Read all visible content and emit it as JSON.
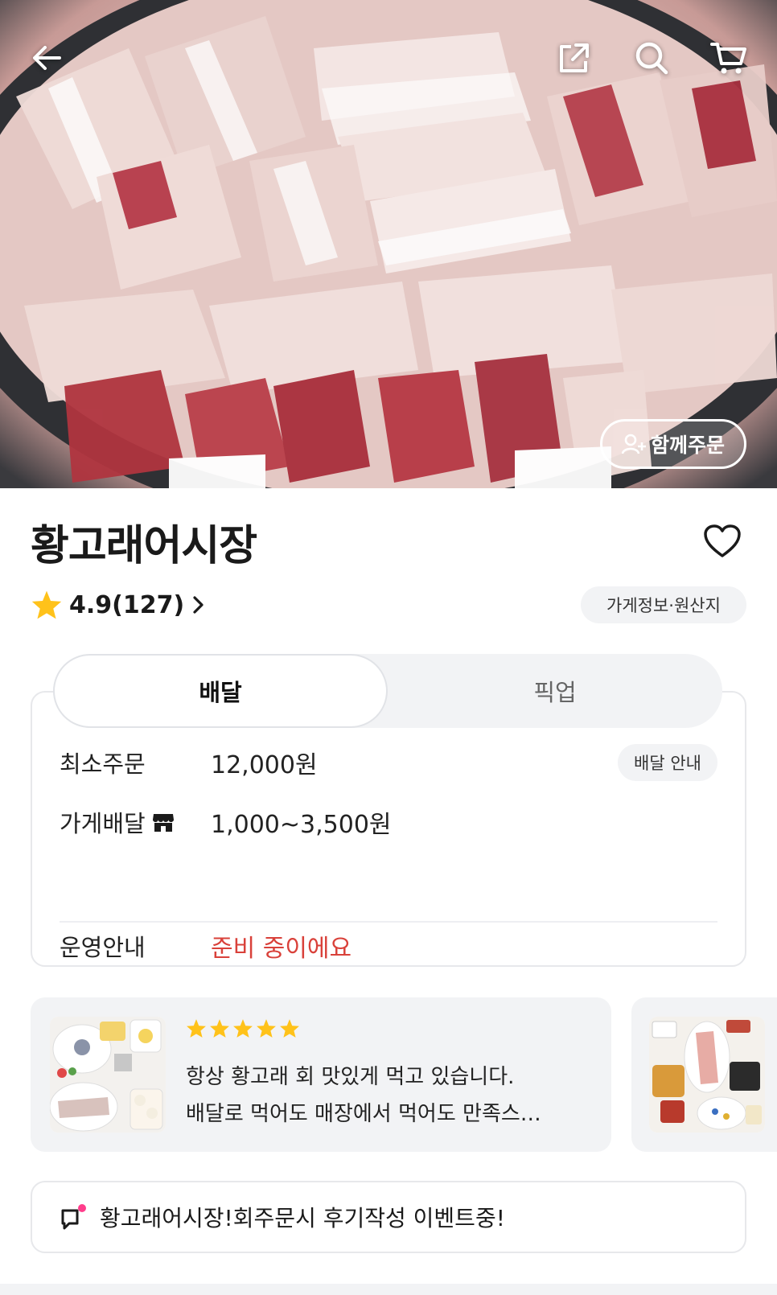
{
  "store": {
    "name": "황고래어시장",
    "rating": "4.9(127)",
    "info_chip": "가게정보·원산지",
    "group_order": "함께주문"
  },
  "tabs": {
    "delivery": "배달",
    "pickup": "픽업",
    "active": "배달"
  },
  "delivery_info": {
    "min_order_label": "최소주문",
    "min_order_value": "12,000원",
    "guide_chip": "배달 안내",
    "fee_label": "가게배달",
    "fee_value": "1,000~3,500원",
    "hours_label": "운영안내",
    "hours_value": "준비 중이에요"
  },
  "review": {
    "stars": 5,
    "line1": "항상 황고래 회 맛있게 먹고 있습니다.",
    "line2": "배달로 먹어도 매장에서 먹어도 만족스…"
  },
  "notice": {
    "text": "황고래어시장!회주문시 후기작성 이벤트중!"
  },
  "colors": {
    "accent_red": "#d9413a",
    "star_yellow": "#ffc21a",
    "chip_bg": "#f2f3f5",
    "notice_dot": "#ff3d8b"
  },
  "icons": [
    "back-arrow-icon",
    "share-icon",
    "search-icon",
    "cart-icon",
    "add-person-icon",
    "heart-icon",
    "star-icon",
    "chevron-right-icon",
    "store-icon",
    "megaphone-icon"
  ]
}
